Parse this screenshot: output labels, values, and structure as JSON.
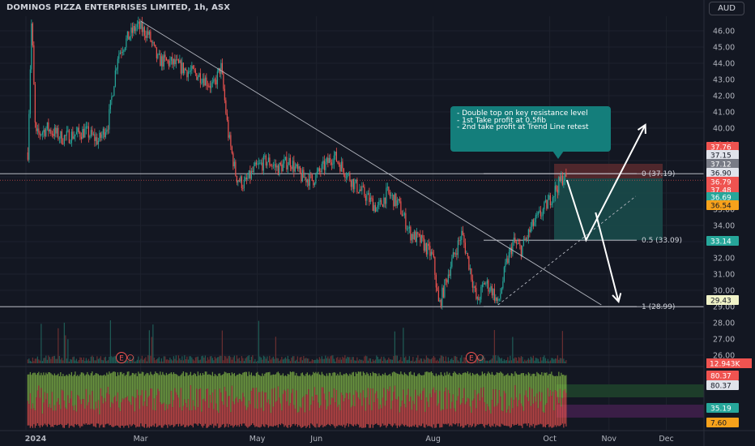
{
  "header": {
    "symbol_title": "DOMINOS PIZZA ENTERPRISES LIMITED, 1h, ASX",
    "currency": "AUD"
  },
  "annotation": {
    "lines": [
      "- Double top on key resistance level",
      "- 1st Take profit at 0.5fib",
      "- 2nd take profit at Trend Line retest"
    ]
  },
  "colors": {
    "background": "#131722",
    "up": "#26a69a",
    "down": "#ef5350",
    "volume_up": "#8bc34a",
    "annotation_bg": "#147e7b",
    "short_position_loss": "#5a2a2e",
    "short_position_profit": "#1a4e4c"
  },
  "chart_data": {
    "type": "candlestick",
    "y_axis": {
      "min": 26.0,
      "max": 47.0,
      "ticks": [
        "46.00",
        "45.00",
        "44.00",
        "43.00",
        "42.00",
        "41.00",
        "40.00",
        "39.00",
        "38.00",
        "37.00",
        "36.00",
        "35.00",
        "34.00",
        "33.00",
        "32.00",
        "31.00",
        "30.00",
        "29.00",
        "28.00",
        "27.00",
        "26.00"
      ]
    },
    "x_axis": {
      "ticks": [
        "2024",
        "Mar",
        "May",
        "Jun",
        "Aug",
        "Oct",
        "Nov",
        "Dec"
      ]
    },
    "price_path": [
      {
        "x": "2024-01-02",
        "y": 38.5
      },
      {
        "x": "2024-01-04",
        "y": 46.8
      },
      {
        "x": "2024-01-06",
        "y": 39.5
      },
      {
        "x": "2024-01-12",
        "y": 40.0
      },
      {
        "x": "2024-01-20",
        "y": 39.4
      },
      {
        "x": "2024-02-01",
        "y": 39.8
      },
      {
        "x": "2024-02-08",
        "y": 39.2
      },
      {
        "x": "2024-02-13",
        "y": 40.3
      },
      {
        "x": "2024-02-18",
        "y": 44.5
      },
      {
        "x": "2024-02-23",
        "y": 45.5
      },
      {
        "x": "2024-02-28",
        "y": 46.3
      },
      {
        "x": "2024-03-05",
        "y": 45.8
      },
      {
        "x": "2024-03-10",
        "y": 44.2
      },
      {
        "x": "2024-03-18",
        "y": 44.0
      },
      {
        "x": "2024-03-26",
        "y": 43.5
      },
      {
        "x": "2024-04-02",
        "y": 43.2
      },
      {
        "x": "2024-04-08",
        "y": 42.5
      },
      {
        "x": "2024-04-12",
        "y": 43.8
      },
      {
        "x": "2024-04-16",
        "y": 39.5
      },
      {
        "x": "2024-04-20",
        "y": 37.0
      },
      {
        "x": "2024-04-24",
        "y": 36.5
      },
      {
        "x": "2024-04-30",
        "y": 37.5
      },
      {
        "x": "2024-05-06",
        "y": 38.0
      },
      {
        "x": "2024-05-12",
        "y": 37.5
      },
      {
        "x": "2024-05-18",
        "y": 38.0
      },
      {
        "x": "2024-05-24",
        "y": 37.0
      },
      {
        "x": "2024-05-30",
        "y": 36.8
      },
      {
        "x": "2024-06-04",
        "y": 37.5
      },
      {
        "x": "2024-06-10",
        "y": 38.3
      },
      {
        "x": "2024-06-15",
        "y": 37.5
      },
      {
        "x": "2024-06-21",
        "y": 36.5
      },
      {
        "x": "2024-06-27",
        "y": 35.8
      },
      {
        "x": "2024-07-03",
        "y": 35.0
      },
      {
        "x": "2024-07-08",
        "y": 36.0
      },
      {
        "x": "2024-07-14",
        "y": 35.3
      },
      {
        "x": "2024-07-20",
        "y": 33.5
      },
      {
        "x": "2024-07-26",
        "y": 33.0
      },
      {
        "x": "2024-08-01",
        "y": 32.0
      },
      {
        "x": "2024-08-04",
        "y": 29.0
      },
      {
        "x": "2024-08-10",
        "y": 31.5
      },
      {
        "x": "2024-08-16",
        "y": 33.5
      },
      {
        "x": "2024-08-20",
        "y": 31.5
      },
      {
        "x": "2024-08-24",
        "y": 29.2
      },
      {
        "x": "2024-08-28",
        "y": 30.5
      },
      {
        "x": "2024-09-01",
        "y": 30.0
      },
      {
        "x": "2024-09-04",
        "y": 29.1
      },
      {
        "x": "2024-09-08",
        "y": 31.5
      },
      {
        "x": "2024-09-12",
        "y": 33.0
      },
      {
        "x": "2024-09-16",
        "y": 32.5
      },
      {
        "x": "2024-09-22",
        "y": 34.0
      },
      {
        "x": "2024-09-28",
        "y": 35.0
      },
      {
        "x": "2024-10-04",
        "y": 36.2
      },
      {
        "x": "2024-10-08",
        "y": 37.0
      },
      {
        "x": "2024-10-10",
        "y": 36.8
      }
    ],
    "trendline": {
      "from": {
        "x": "2024-03-01",
        "y": 46.6
      },
      "to": {
        "x": "2024-10-28",
        "y": 29.1
      }
    },
    "horizontal_levels": [
      37.19,
      28.99
    ],
    "fib_levels": [
      {
        "label": "0 (37.19)",
        "value": 37.19
      },
      {
        "label": "0.5 (33.09)",
        "value": 33.09
      },
      {
        "label": "1 (28.99)",
        "value": 28.99
      }
    ],
    "short_position": {
      "entry": 36.9,
      "stop": 37.8,
      "target": 33.09
    },
    "projection_arrows": [
      [
        {
          "x": "2024-10-10",
          "y": 36.8
        },
        {
          "x": "2024-10-20",
          "y": 33.1
        },
        {
          "x": "2024-11-20",
          "y": 40.2
        }
      ],
      [
        {
          "x": "2024-10-25",
          "y": 34.8
        },
        {
          "x": "2024-11-06",
          "y": 29.3
        }
      ]
    ],
    "dashed_projection": {
      "from": {
        "x": "2024-09-04",
        "y": 29.1
      },
      "to": {
        "x": "2024-11-15",
        "y": 35.8
      }
    },
    "price_labels": [
      {
        "text": "37.76",
        "value": 37.76,
        "bg": "#ef5350",
        "fg": "#ffffff"
      },
      {
        "text": "37.15",
        "value": 37.15,
        "bg": "#e0e3eb",
        "fg": "#131722"
      },
      {
        "text": "37.12",
        "value": 37.12,
        "bg": "#787b86",
        "fg": "#ffffff"
      },
      {
        "text": "36.90",
        "value": 36.9,
        "bg": "#e0e3eb",
        "fg": "#131722"
      },
      {
        "text": "36.79",
        "value": 36.79,
        "bg": "#ef5350",
        "fg": "#ffffff"
      },
      {
        "text": "37.48",
        "value": 36.55,
        "bg": "#ef5350",
        "fg": "#ffffff"
      },
      {
        "text": "36.69",
        "value": 36.0,
        "bg": "#26a69a",
        "fg": "#ffffff"
      },
      {
        "text": "36.54",
        "value": 35.55,
        "bg": "#f7a21b",
        "fg": "#131722"
      },
      {
        "text": "33.14",
        "value": 33.14,
        "bg": "#26a69a",
        "fg": "#ffffff"
      },
      {
        "text": "29.43",
        "value": 29.43,
        "bg": "#f0f3c8",
        "fg": "#131722"
      }
    ],
    "volume_label": "12.943K",
    "earnings_markers": [
      {
        "x": "2024-02-20",
        "label": "E"
      },
      {
        "x": "2024-08-21",
        "label": "E"
      }
    ],
    "oscillator": {
      "levels": [
        80.37,
        35.19
      ],
      "level_labels": [
        {
          "text": "80.37",
          "bg": "#ef5350"
        },
        {
          "text": "80.37",
          "bg": "#e0e3eb"
        },
        {
          "text": "35.19",
          "bg": "#26a69a"
        },
        {
          "text": "7.60",
          "bg": "#f7a21b"
        }
      ]
    },
    "title": "DOMINOS PIZZA ENTERPRISES LIMITED, 1h, ASX",
    "xlabel": "",
    "ylabel": ""
  }
}
